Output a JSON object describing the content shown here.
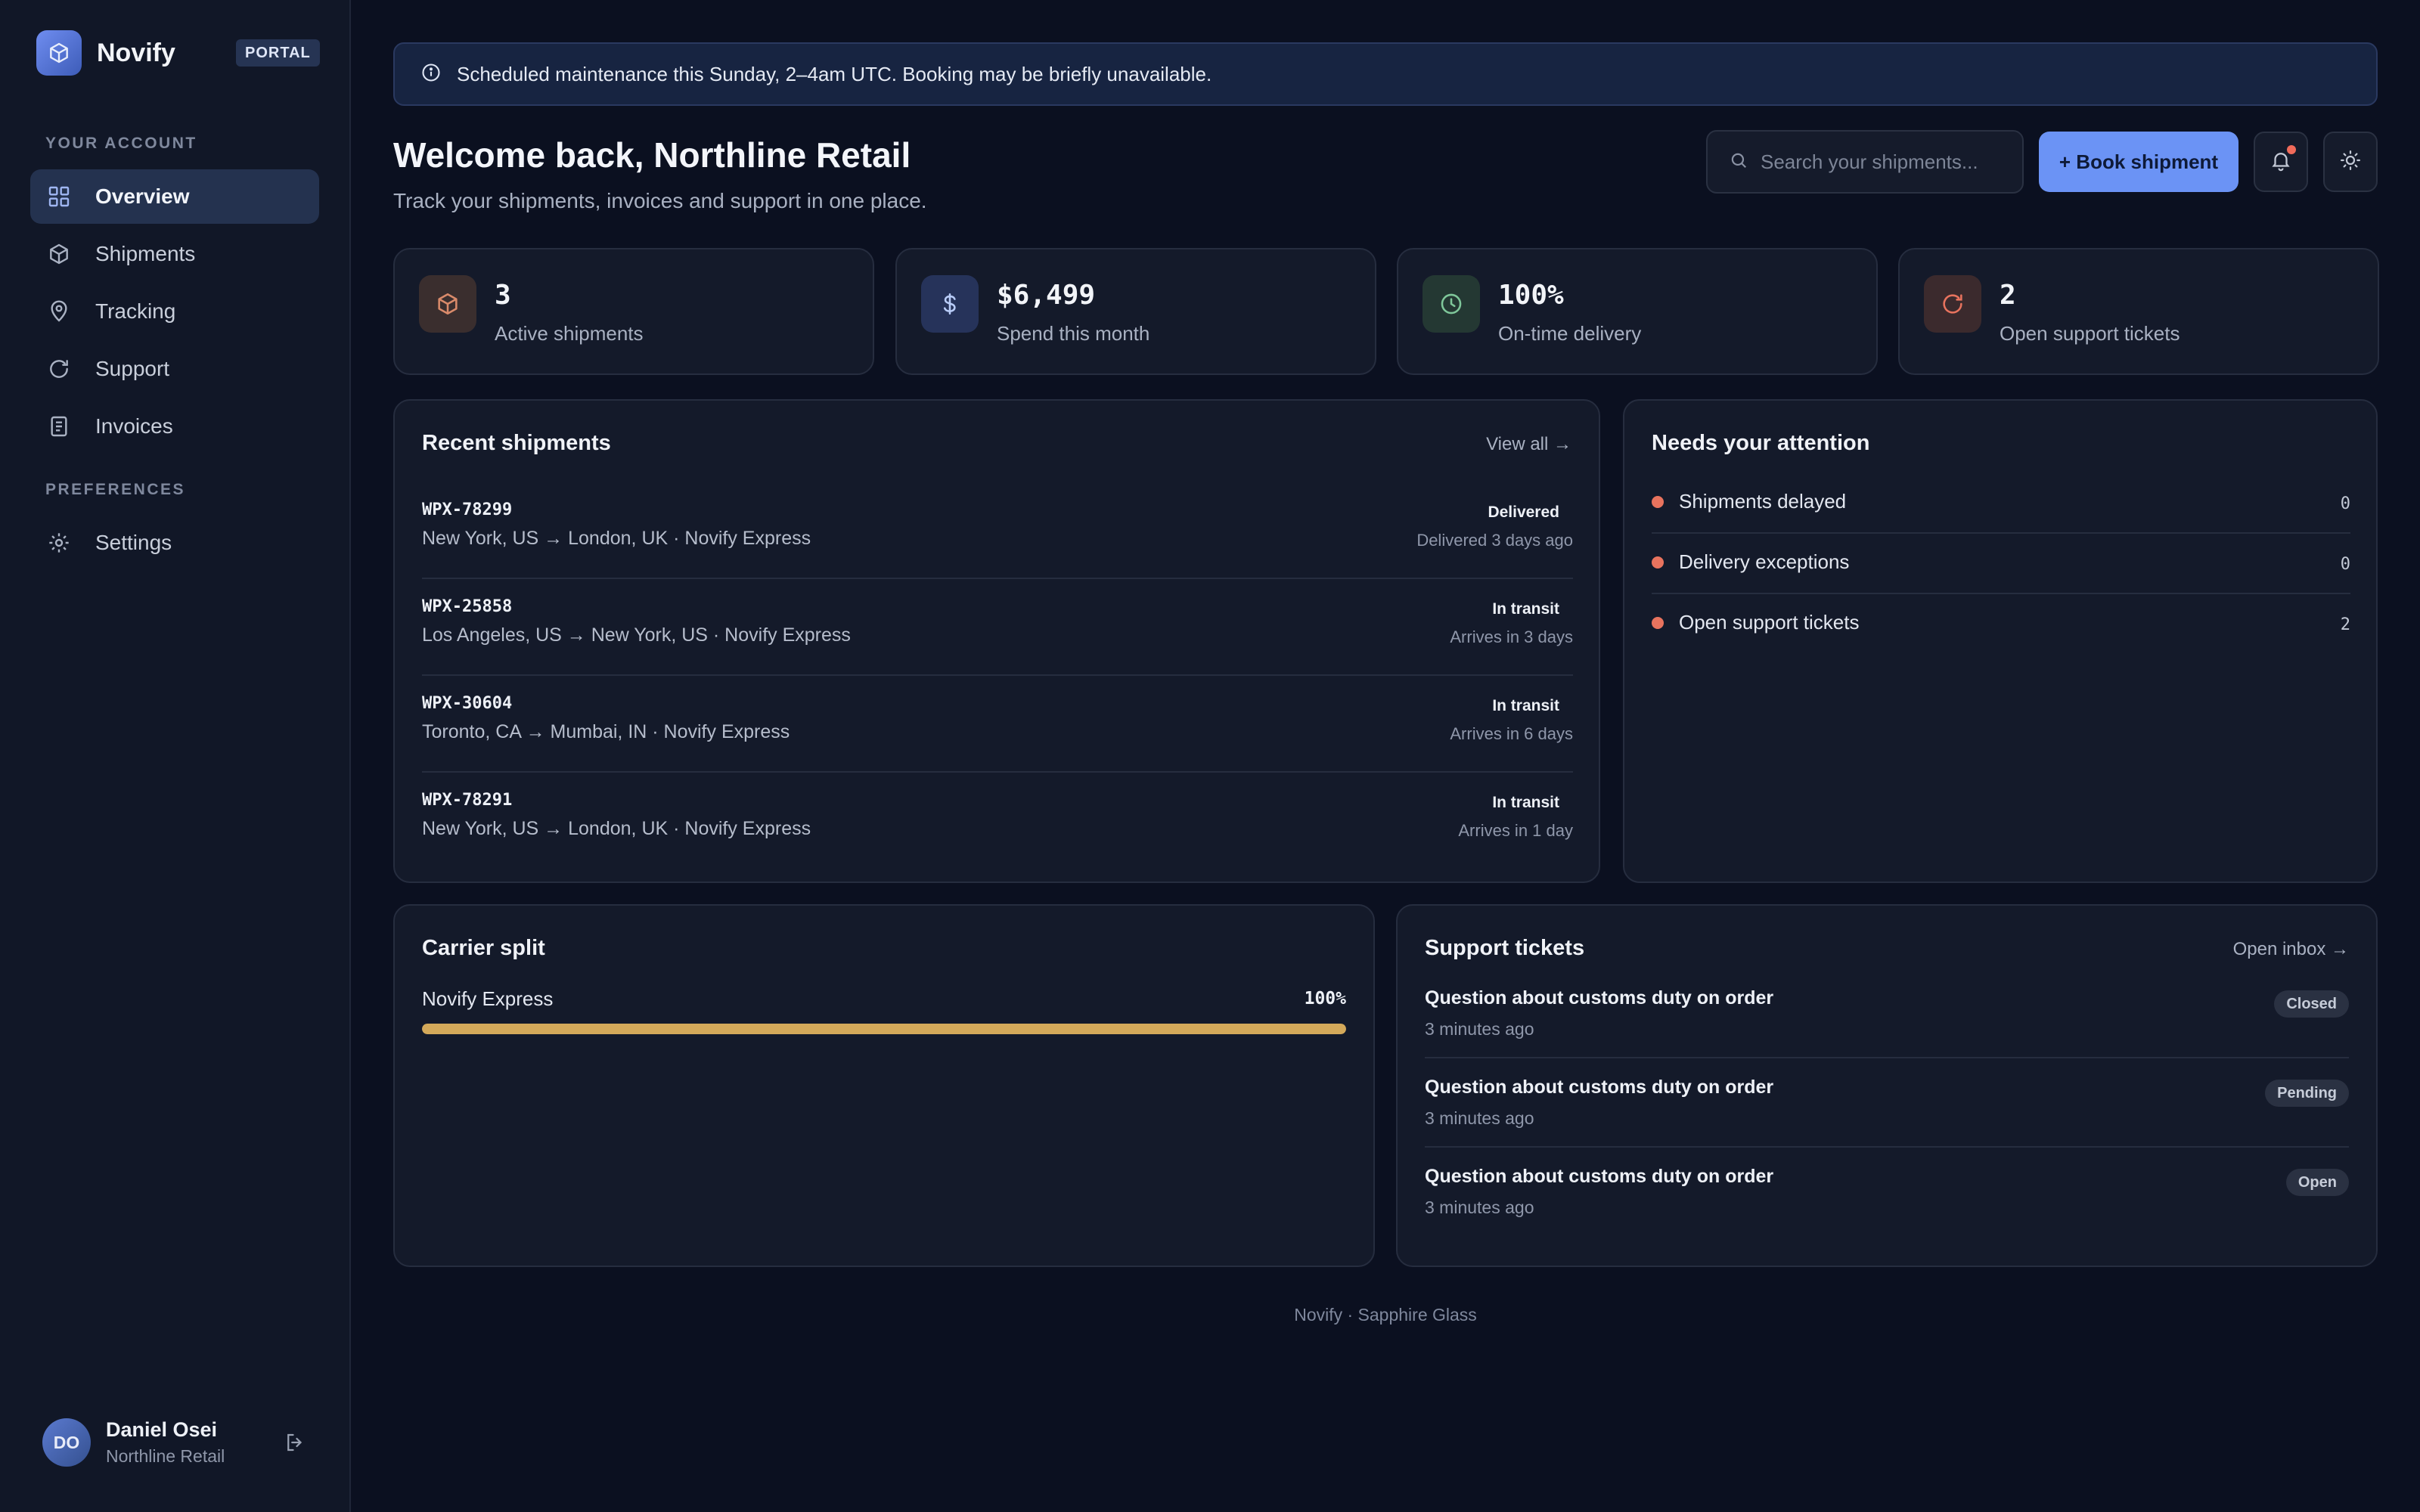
{
  "brand": {
    "name": "Novify",
    "badge": "PORTAL"
  },
  "sidebar": {
    "sections": [
      "YOUR ACCOUNT",
      "PREFERENCES"
    ],
    "items": [
      {
        "label": "Overview",
        "icon": "grid-icon",
        "active": true
      },
      {
        "label": "Shipments",
        "icon": "box-icon"
      },
      {
        "label": "Tracking",
        "icon": "map-pin-icon"
      },
      {
        "label": "Support",
        "icon": "refresh-icon"
      },
      {
        "label": "Invoices",
        "icon": "document-icon"
      },
      {
        "label": "Settings",
        "icon": "gear-icon"
      }
    ]
  },
  "user": {
    "initials": "DO",
    "name": "Daniel Osei",
    "org": "Northline Retail"
  },
  "banner": {
    "text": "Scheduled maintenance this Sunday, 2–4am UTC. Booking may be briefly unavailable."
  },
  "header": {
    "title": "Welcome back, Northline Retail",
    "subtitle": "Track your shipments, invoices and support in one place.",
    "search_placeholder": "Search your shipments...",
    "book_label": "+ Book shipment"
  },
  "stats": [
    {
      "value": "3",
      "label": "Active shipments",
      "icon": "box-icon",
      "color": "#d98a6a"
    },
    {
      "value": "$6,499",
      "label": "Spend this month",
      "icon": "dollar-icon",
      "color": "#8fb0f5"
    },
    {
      "value": "100%",
      "label": "On-time delivery",
      "icon": "clock-icon",
      "color": "#7fc79a"
    },
    {
      "value": "2",
      "label": "Open support tickets",
      "icon": "refresh-icon",
      "color": "#e8735e"
    }
  ],
  "recent": {
    "title": "Recent shipments",
    "view_all": "View all →",
    "rows": [
      {
        "id": "WPX-78299",
        "route": "New York, US → London, UK · Novify Express",
        "status": "Delivered",
        "eta": "Delivered 3 days ago"
      },
      {
        "id": "WPX-25858",
        "route": "Los Angeles, US → New York, US · Novify Express",
        "status": "In transit",
        "eta": "Arrives in 3 days"
      },
      {
        "id": "WPX-30604",
        "route": "Toronto, CA → Mumbai, IN · Novify Express",
        "status": "In transit",
        "eta": "Arrives in 6 days"
      },
      {
        "id": "WPX-78291",
        "route": "New York, US → London, UK · Novify Express",
        "status": "In transit",
        "eta": "Arrives in 1 day"
      }
    ]
  },
  "attention": {
    "title": "Needs your attention",
    "rows": [
      {
        "label": "Shipments delayed",
        "count": "0"
      },
      {
        "label": "Delivery exceptions",
        "count": "0"
      },
      {
        "label": "Open support tickets",
        "count": "2"
      }
    ]
  },
  "carrier": {
    "title": "Carrier split",
    "rows": [
      {
        "name": "Novify Express",
        "pct_label": "100%",
        "fraction": 1.0
      }
    ]
  },
  "tickets": {
    "title": "Support tickets",
    "link": "Open inbox →",
    "rows": [
      {
        "title": "Question about customs duty on order",
        "time": "3 minutes ago",
        "status": "Closed"
      },
      {
        "title": "Question about customs duty on order",
        "time": "3 minutes ago",
        "status": "Pending"
      },
      {
        "title": "Question about customs duty on order",
        "time": "3 minutes ago",
        "status": "Open"
      }
    ]
  },
  "footer": "Novify · Sapphire Glass"
}
